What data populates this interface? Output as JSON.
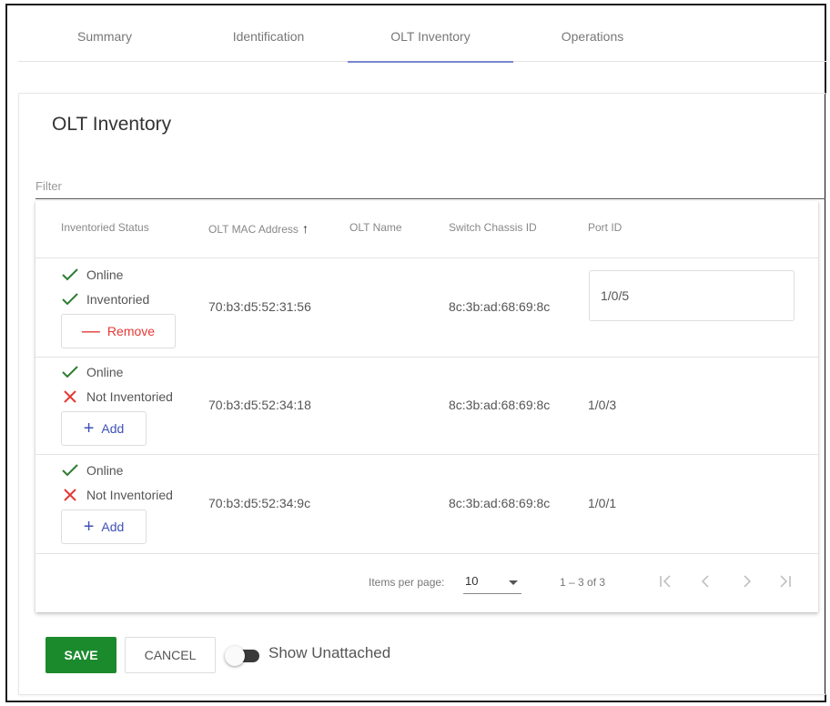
{
  "tabs": [
    {
      "label": "Summary"
    },
    {
      "label": "Identification"
    },
    {
      "label": "OLT Inventory"
    },
    {
      "label": "Operations"
    }
  ],
  "active_tab": "OLT Inventory",
  "card": {
    "title": "OLT Inventory",
    "filter_label": "Filter"
  },
  "table": {
    "columns": {
      "status": "Inventoried Status",
      "mac": "OLT MAC Address",
      "name": "OLT Name",
      "chassis": "Switch Chassis ID",
      "port": "Port ID"
    },
    "sort": {
      "column": "mac",
      "direction": "asc"
    },
    "rows": [
      {
        "online": "Online",
        "inventory": "Inventoried",
        "inventoried": true,
        "action": "Remove",
        "mac": "70:b3:d5:52:31:56",
        "name": "",
        "chassis": "8c:3b:ad:68:69:8c",
        "port": "1/0/5",
        "port_editable": true
      },
      {
        "online": "Online",
        "inventory": "Not Inventoried",
        "inventoried": false,
        "action": "Add",
        "mac": "70:b3:d5:52:34:18",
        "name": "",
        "chassis": "8c:3b:ad:68:69:8c",
        "port": "1/0/3",
        "port_editable": false
      },
      {
        "online": "Online",
        "inventory": "Not Inventoried",
        "inventoried": false,
        "action": "Add",
        "mac": "70:b3:d5:52:34:9c",
        "name": "",
        "chassis": "8c:3b:ad:68:69:8c",
        "port": "1/0/1",
        "port_editable": false
      }
    ]
  },
  "paginator": {
    "items_label": "Items per page:",
    "page_size": "10",
    "range": "1 – 3 of 3"
  },
  "actions": {
    "save": "SAVE",
    "cancel": "CANCEL",
    "toggle_label": "Show Unattached",
    "toggle_on": false
  },
  "colors": {
    "check": "#2e7d32",
    "cross": "#e53935",
    "save": "#1b8a2c",
    "tab_indicator": "#7986cb",
    "add": "#3f51b5"
  }
}
